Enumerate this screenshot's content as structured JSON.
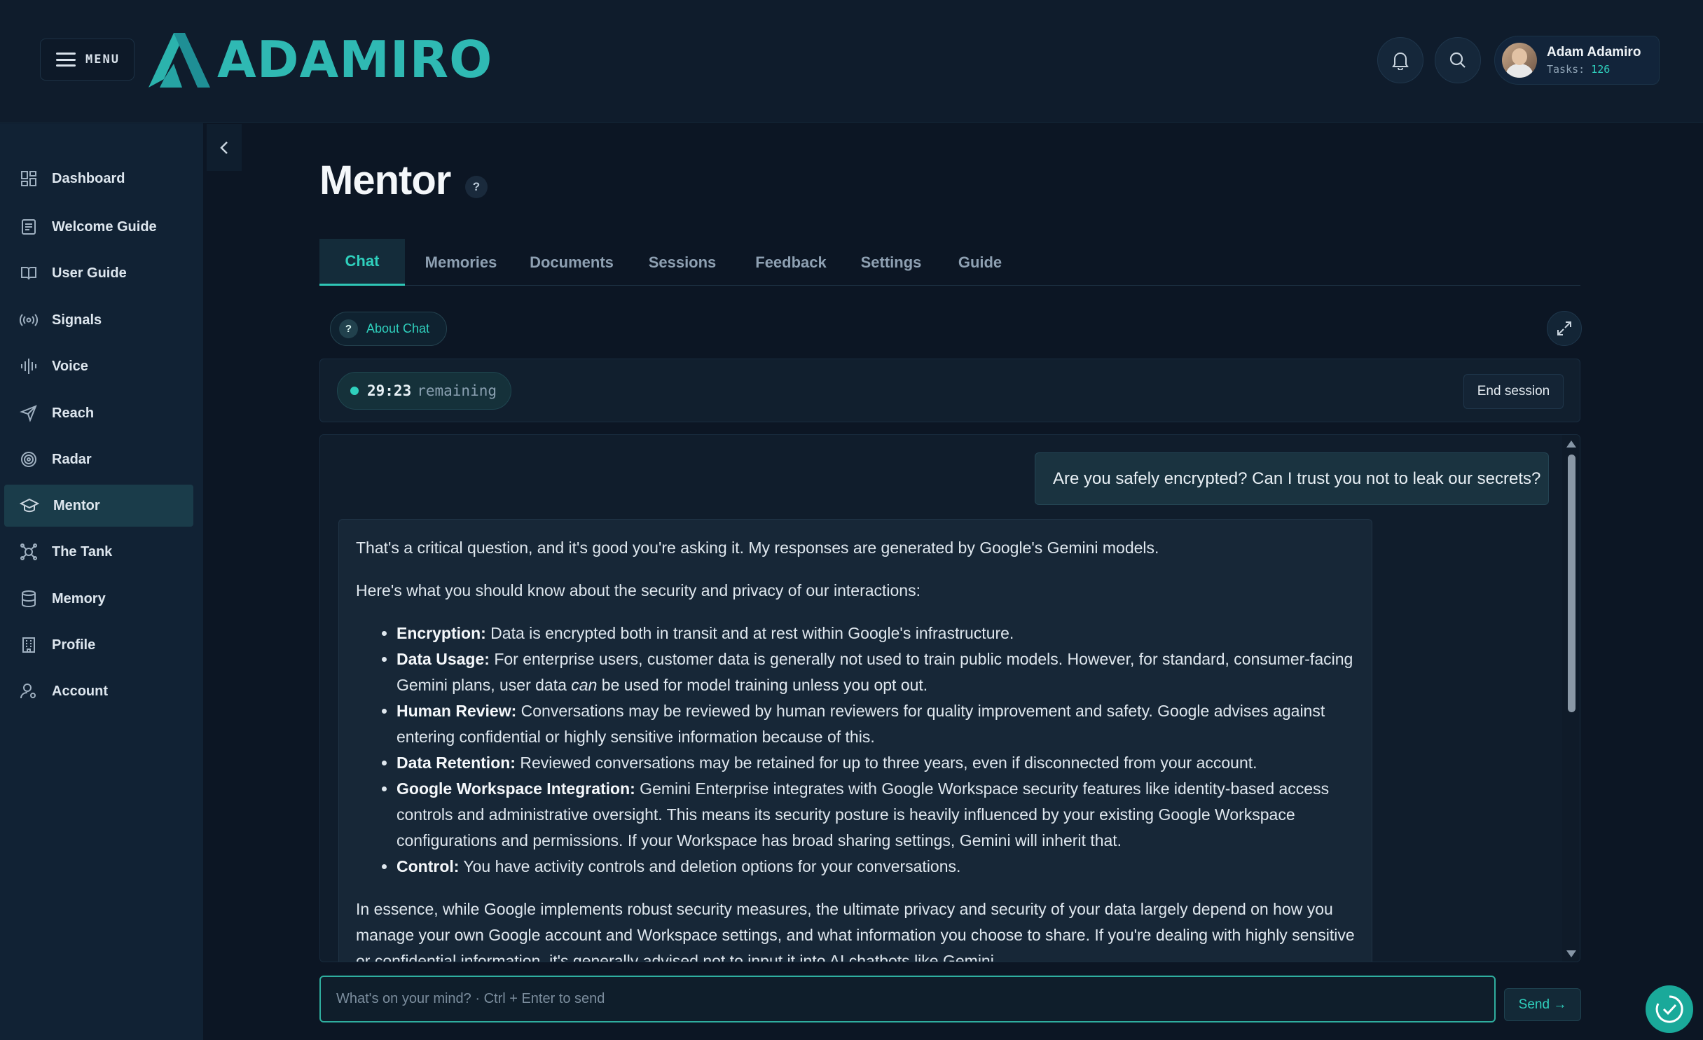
{
  "header": {
    "menu_label": "MENU",
    "logo_text": "ADAMIRO",
    "user": {
      "name": "Adam Adamiro",
      "tasks_label": "Tasks:",
      "tasks_count": "126"
    }
  },
  "sidebar": {
    "items": [
      {
        "label": "Dashboard",
        "icon": "dashboard-icon"
      },
      {
        "label": "Welcome Guide",
        "icon": "document-icon"
      },
      {
        "label": "User Guide",
        "icon": "book-icon"
      },
      {
        "label": "Signals",
        "icon": "signal-icon"
      },
      {
        "label": "Voice",
        "icon": "waveform-icon"
      },
      {
        "label": "Reach",
        "icon": "send-icon"
      },
      {
        "label": "Radar",
        "icon": "radar-icon"
      },
      {
        "label": "Mentor",
        "icon": "graduation-cap-icon",
        "active": true
      },
      {
        "label": "The Tank",
        "icon": "tank-icon"
      },
      {
        "label": "Memory",
        "icon": "database-icon"
      },
      {
        "label": "Profile",
        "icon": "building-icon"
      },
      {
        "label": "Account",
        "icon": "user-gear-icon"
      }
    ]
  },
  "page": {
    "title": "Mentor",
    "help": "?",
    "tabs": [
      "Chat",
      "Memories",
      "Documents",
      "Sessions",
      "Feedback",
      "Settings",
      "Guide"
    ],
    "active_tab": "Chat",
    "about_label": "About Chat",
    "about_q": "?"
  },
  "session": {
    "time": "29:23",
    "remaining": "remaining",
    "end_label": "End session"
  },
  "chat": {
    "user_message": "Are you safely encrypted? Can I trust you not to leak our secrets?",
    "bot": {
      "intro": "That's a critical question, and it's good you're asking it. My responses are generated by Google's Gemini models.",
      "lead": "Here's what you should know about the security and privacy of our interactions:",
      "points": [
        {
          "term": "Encryption:",
          "text": " Data is encrypted both in transit and at rest within Google's infrastructure."
        },
        {
          "term": "Data Usage:",
          "text": " For enterprise users, customer data is generally not used to train public models. However, for standard, consumer-facing Gemini plans, user data ",
          "em": "can",
          "rest": " be used for model training unless you opt out."
        },
        {
          "term": "Human Review:",
          "text": " Conversations may be reviewed by human reviewers for quality improvement and safety. Google advises against entering confidential or highly sensitive information because of this."
        },
        {
          "term": "Data Retention:",
          "text": " Reviewed conversations may be retained for up to three years, even if disconnected from your account."
        },
        {
          "term": "Google Workspace Integration:",
          "text": " Gemini Enterprise integrates with Google Workspace security features like identity-based access controls and administrative oversight. This means its security posture is heavily influenced by your existing Google Workspace configurations and permissions. If your Workspace has broad sharing settings, Gemini will inherit that."
        },
        {
          "term": "Control:",
          "text": " You have activity controls and deletion options for your conversations."
        }
      ],
      "summary": "In essence, while Google implements robust security measures, the ultimate privacy and security of your data largely depend on how you manage your own Google account and Workspace settings, and what information you choose to share. If you're dealing with highly sensitive or confidential information, it's generally advised not to input it into AI chatbots like Gemini."
    }
  },
  "composer": {
    "placeholder": "What's on your mind? · Ctrl + Enter to send",
    "value": "",
    "send_label": "Send →"
  },
  "colors": {
    "accent": "#2fd0bd",
    "background": "#0c1624",
    "sidebar": "#112234"
  }
}
